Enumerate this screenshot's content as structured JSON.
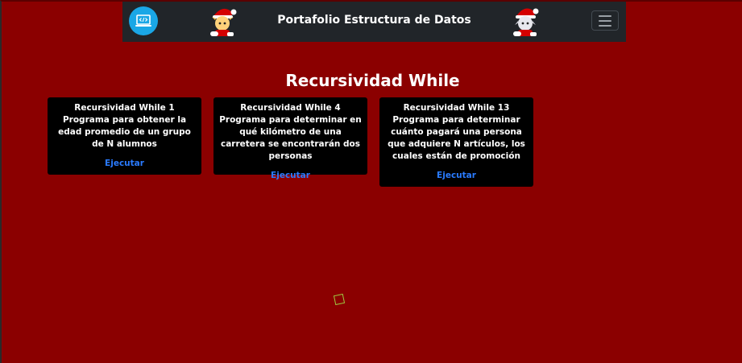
{
  "navbar": {
    "brand_title": "Portafolio Estructura de Datos",
    "logo_icon": "code-laptop-icon",
    "mascot_left_icon": "santa-mascot-icon",
    "mascot_right_icon": "santa-mascot-icon",
    "toggler_icon": "hamburger-menu-icon"
  },
  "page": {
    "heading": "Recursividad While",
    "background_color": "#8b0000"
  },
  "cards": [
    {
      "title": "Recursividad While 1",
      "description": "Programa para obtener la edad promedio de un grupo de N alumnos",
      "link_label": "Ejecutar"
    },
    {
      "title": "Recursividad While 4",
      "description": "Programa para determinar en qué kilómetro de una carretera se encontrarán dos personas",
      "link_label": "Ejecutar"
    },
    {
      "title": "Recursividad While 13",
      "description": "Programa para determinar cuánto pagará una persona que adquiere N artículos, los cuales están de promoción",
      "link_label": "Ejecutar"
    }
  ],
  "colors": {
    "navbar_bg": "#212529",
    "card_bg": "#000000",
    "link": "#2a7bff",
    "logo_bg": "#1aa7e6"
  }
}
